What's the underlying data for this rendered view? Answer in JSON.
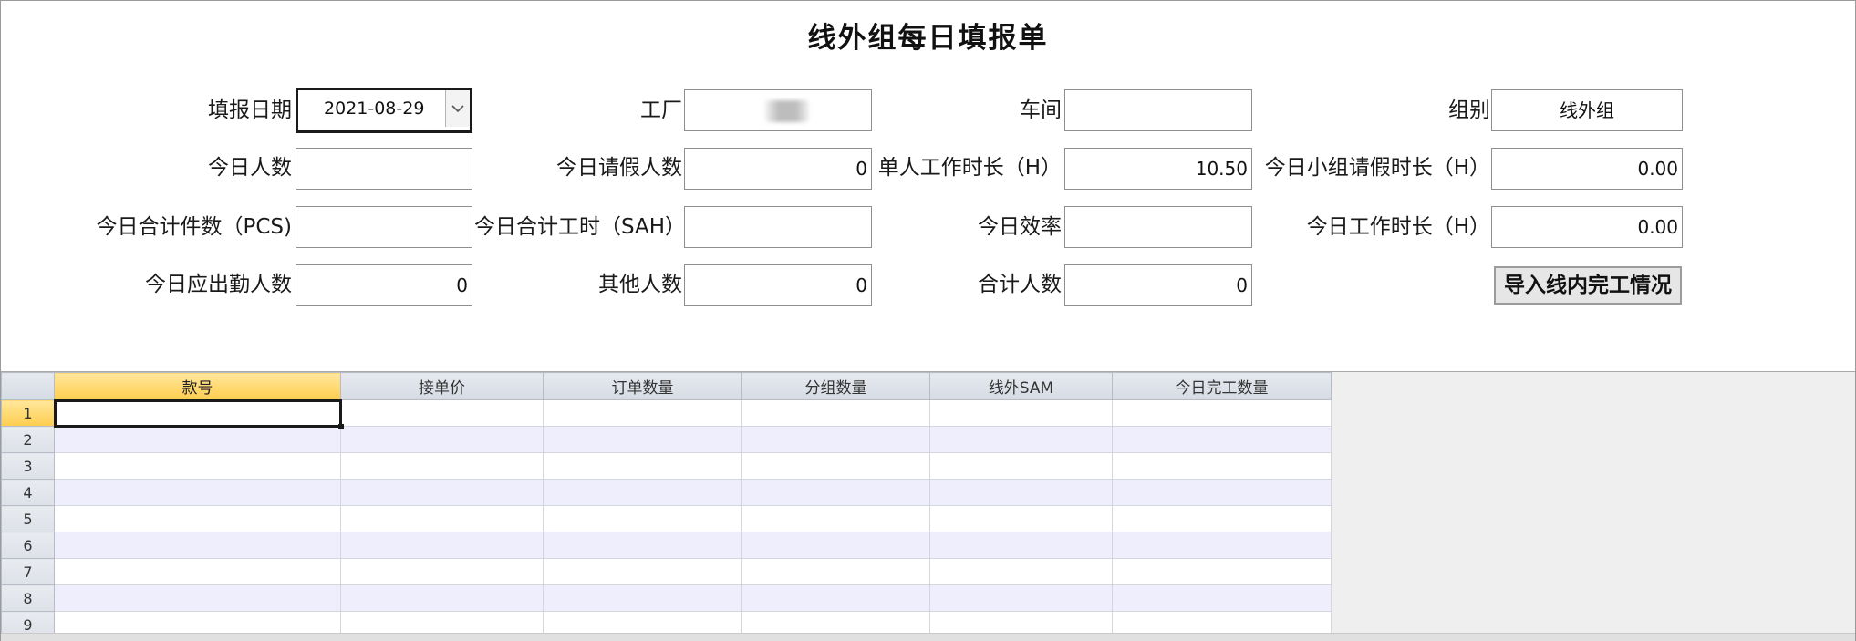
{
  "form": {
    "title": "线外组每日填报单",
    "fields": {
      "report_date": {
        "label": "填报日期",
        "value": "2021-08-29"
      },
      "factory": {
        "label": "工厂",
        "value": ""
      },
      "workshop": {
        "label": "车间",
        "value": ""
      },
      "group": {
        "label": "组别",
        "value": "线外组"
      },
      "today_headcount": {
        "label": "今日人数",
        "value": ""
      },
      "leave_count": {
        "label": "今日请假人数",
        "value": "0"
      },
      "work_hours_per_person": {
        "label": "单人工作时长（H）",
        "value": "10.50"
      },
      "group_leave_hours": {
        "label": "今日小组请假时长（H）",
        "value": "0.00"
      },
      "total_pieces": {
        "label": "今日合计件数（PCS)",
        "value": ""
      },
      "total_sah": {
        "label": "今日合计工时（SAH）",
        "value": ""
      },
      "efficiency": {
        "label": "今日效率",
        "value": ""
      },
      "work_hours_today": {
        "label": "今日工作时长（H）",
        "value": "0.00"
      },
      "expected_attendance": {
        "label": "今日应出勤人数",
        "value": "0"
      },
      "other_count": {
        "label": "其他人数",
        "value": "0"
      },
      "total_count": {
        "label": "合计人数",
        "value": "0"
      }
    },
    "import_button": "导入线内完工情况"
  },
  "grid": {
    "columns": [
      "款号",
      "接单价",
      "订单数量",
      "分组数量",
      "线外SAM",
      "今日完工数量"
    ],
    "rows": [
      "1",
      "2",
      "3",
      "4",
      "5",
      "6",
      "7",
      "8",
      "9"
    ]
  }
}
